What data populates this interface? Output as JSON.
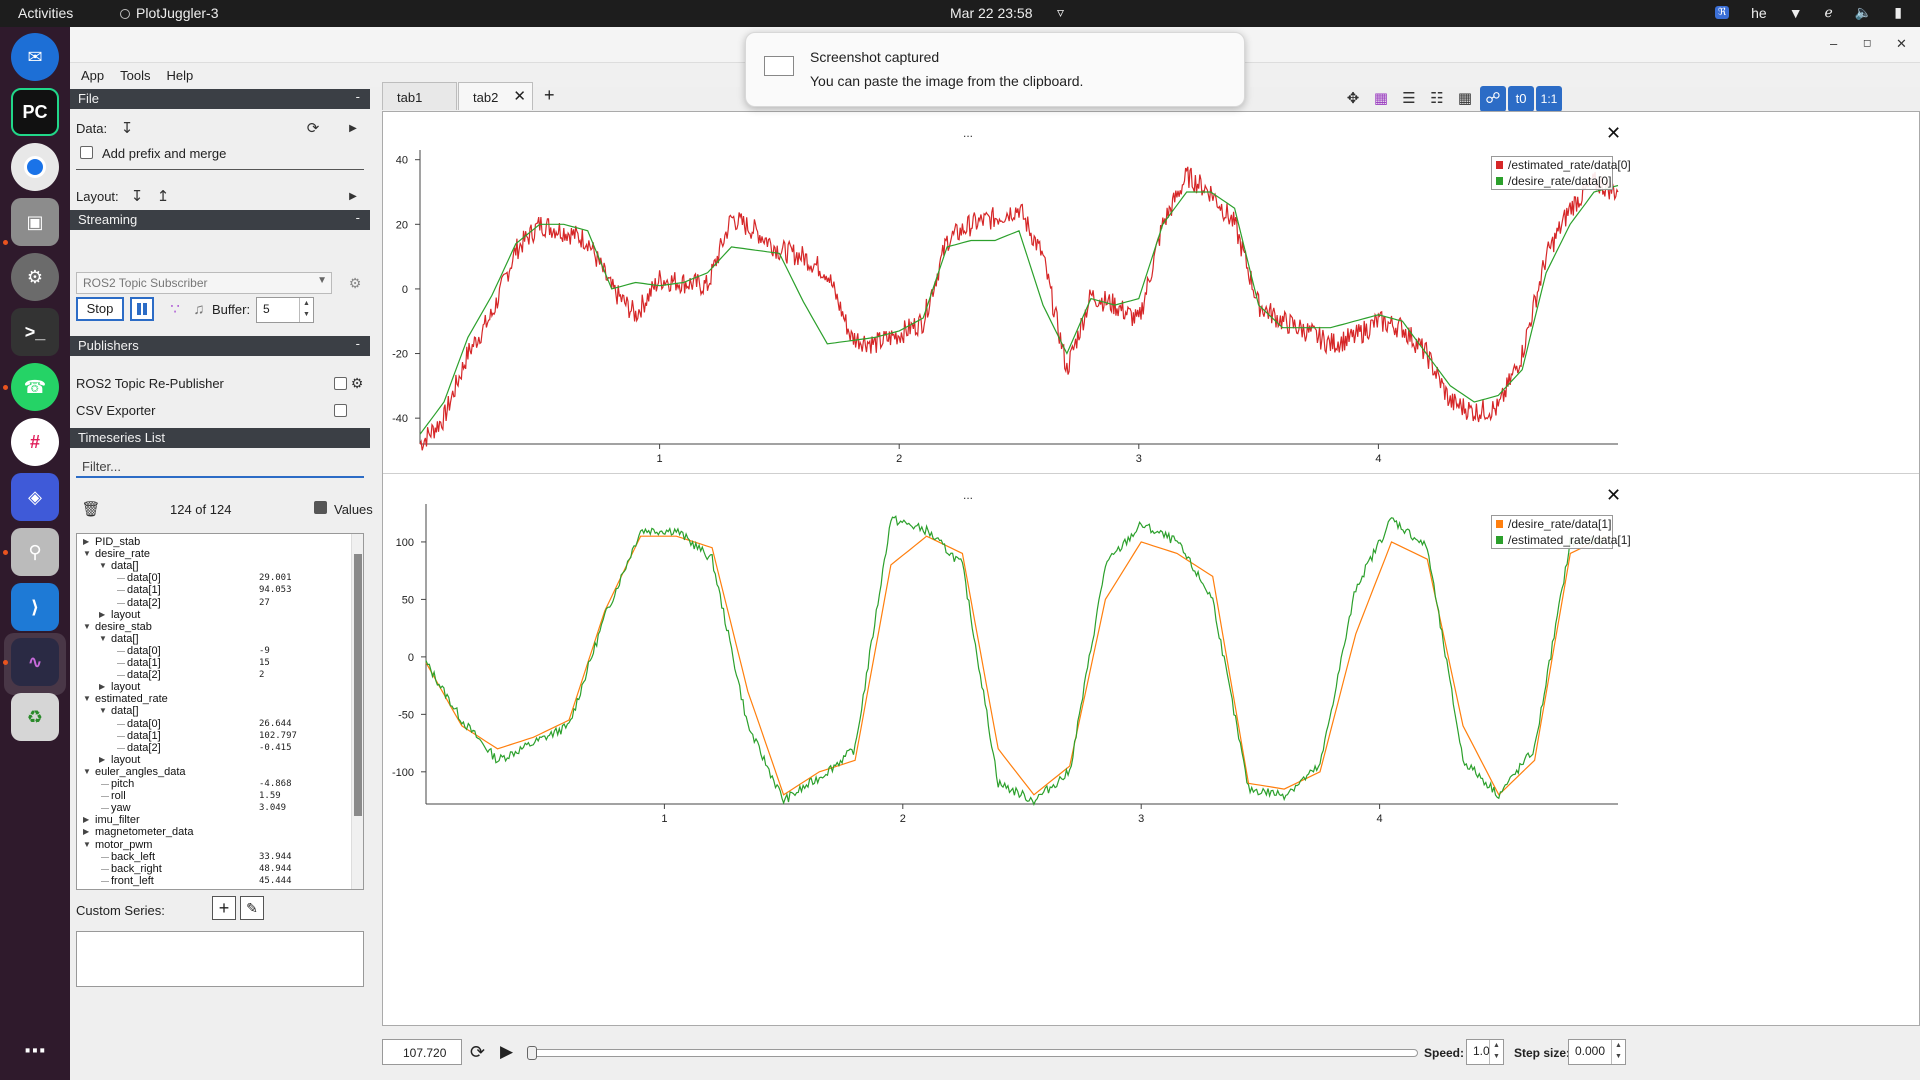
{
  "topbar": {
    "activities": "Activities",
    "app_name": "PlotJuggler-3",
    "clock": "Mar 22  23:58",
    "lang": "he"
  },
  "notification": {
    "title": "Screenshot captured",
    "body": "You can paste the image from the clipboard."
  },
  "menu": [
    "App",
    "Tools",
    "Help"
  ],
  "file": {
    "header": "File",
    "data_label": "Data:",
    "prefix_label": "Add prefix and merge",
    "layout_label": "Layout:"
  },
  "streaming": {
    "header": "Streaming",
    "source": "ROS2 Topic Subscriber",
    "stop_label": "Stop",
    "buffer_label": "Buffer:",
    "buffer_value": "5"
  },
  "publishers": {
    "header": "Publishers",
    "items": [
      "ROS2 Topic Re-Publisher",
      "CSV Exporter"
    ]
  },
  "timeseries": {
    "header": "Timeseries List",
    "filter_placeholder": "Filter...",
    "count": "124 of 124",
    "values_label": "Values",
    "tree": [
      {
        "label": "PID_stab",
        "level": 0,
        "expanded": false
      },
      {
        "label": "desire_rate",
        "level": 0,
        "expanded": true
      },
      {
        "label": "data[]",
        "level": 1,
        "expanded": true
      },
      {
        "label": "data[0]",
        "level": 2,
        "value": "29.001"
      },
      {
        "label": "data[1]",
        "level": 2,
        "value": "94.053"
      },
      {
        "label": "data[2]",
        "level": 2,
        "value": "27"
      },
      {
        "label": "layout",
        "level": 1,
        "expanded": false
      },
      {
        "label": "desire_stab",
        "level": 0,
        "expanded": true
      },
      {
        "label": "data[]",
        "level": 1,
        "expanded": true
      },
      {
        "label": "data[0]",
        "level": 2,
        "value": "-9"
      },
      {
        "label": "data[1]",
        "level": 2,
        "value": "15"
      },
      {
        "label": "data[2]",
        "level": 2,
        "value": "2"
      },
      {
        "label": "layout",
        "level": 1,
        "expanded": false
      },
      {
        "label": "estimated_rate",
        "level": 0,
        "expanded": true
      },
      {
        "label": "data[]",
        "level": 1,
        "expanded": true
      },
      {
        "label": "data[0]",
        "level": 2,
        "value": "26.644"
      },
      {
        "label": "data[1]",
        "level": 2,
        "value": "102.797"
      },
      {
        "label": "data[2]",
        "level": 2,
        "value": "-0.415"
      },
      {
        "label": "layout",
        "level": 1,
        "expanded": false
      },
      {
        "label": "euler_angles_data",
        "level": 0,
        "expanded": true
      },
      {
        "label": "pitch",
        "level": 1,
        "value": "-4.868"
      },
      {
        "label": "roll",
        "level": 1,
        "value": "1.59"
      },
      {
        "label": "yaw",
        "level": 1,
        "value": "3.049"
      },
      {
        "label": "imu_filter",
        "level": 0,
        "expanded": false
      },
      {
        "label": "magnetometer_data",
        "level": 0,
        "expanded": false
      },
      {
        "label": "motor_pwm",
        "level": 0,
        "expanded": true
      },
      {
        "label": "back_left",
        "level": 1,
        "value": "33.944"
      },
      {
        "label": "back_right",
        "level": 1,
        "value": "48.944"
      },
      {
        "label": "front_left",
        "level": 1,
        "value": "45.444"
      }
    ],
    "custom_series_label": "Custom Series:"
  },
  "tabs": [
    {
      "label": "tab1",
      "active": false
    },
    {
      "label": "tab2",
      "active": true
    }
  ],
  "add_tab": "+",
  "toolbar_icons": [
    "move-icon",
    "grid-lines-icon",
    "legend-icon",
    "settings-icon",
    "grid-icon",
    "link-icon",
    "t0-icon",
    "ratio-icon"
  ],
  "toolbar_text": {
    "t0": "t0",
    "ratio": "1:1"
  },
  "plots": {
    "top": {
      "title": "...",
      "legend": [
        "/estimated_rate/data[0]",
        "/desire_rate/data[0]"
      ]
    },
    "bottom": {
      "title": "...",
      "legend": [
        "/desire_rate/data[1]",
        "/estimated_rate/data[1]"
      ]
    }
  },
  "chart_data": [
    {
      "type": "line",
      "xlim": [
        0,
        5
      ],
      "ylim": [
        -48,
        43
      ],
      "xticks": [
        "1",
        "2",
        "3",
        "4"
      ],
      "yticks": [
        "40",
        "20",
        "0",
        "-20",
        "-40"
      ],
      "series": [
        {
          "name": "/estimated_rate/data[0]",
          "color": "#d62728",
          "x": [
            0,
            0.1,
            0.2,
            0.3,
            0.4,
            0.5,
            0.6,
            0.7,
            0.8,
            0.9,
            1.0,
            1.1,
            1.2,
            1.3,
            1.4,
            1.5,
            1.6,
            1.7,
            1.8,
            1.9,
            2.0,
            2.1,
            2.2,
            2.3,
            2.4,
            2.5,
            2.6,
            2.7,
            2.8,
            2.9,
            3.0,
            3.1,
            3.2,
            3.3,
            3.4,
            3.5,
            3.6,
            3.7,
            3.8,
            3.9,
            4.0,
            4.1,
            4.2,
            4.3,
            4.4,
            4.5,
            4.6,
            4.7,
            4.8,
            4.9,
            5.0
          ],
          "y": [
            -48,
            -40,
            -20,
            -8,
            12,
            20,
            18,
            15,
            0,
            -8,
            3,
            2,
            1,
            22,
            18,
            12,
            10,
            5,
            -15,
            -17,
            -14,
            -10,
            15,
            20,
            22,
            25,
            10,
            -25,
            -2,
            -5,
            -10,
            20,
            35,
            30,
            20,
            -5,
            -10,
            -13,
            -17,
            -15,
            -10,
            -12,
            -20,
            -35,
            -38,
            -37,
            -20,
            10,
            25,
            33,
            30
          ]
        },
        {
          "name": "/desire_rate/data[0]",
          "color": "#2ca02c",
          "x": [
            0,
            0.1,
            0.2,
            0.3,
            0.4,
            0.5,
            0.6,
            0.7,
            0.8,
            0.9,
            1.0,
            1.1,
            1.2,
            1.3,
            1.4,
            1.5,
            1.6,
            1.7,
            1.8,
            1.9,
            2.0,
            2.1,
            2.2,
            2.3,
            2.4,
            2.5,
            2.6,
            2.7,
            2.8,
            2.9,
            3.0,
            3.1,
            3.2,
            3.3,
            3.4,
            3.5,
            3.6,
            3.7,
            3.8,
            3.9,
            4.0,
            4.1,
            4.2,
            4.3,
            4.4,
            4.5,
            4.6,
            4.7,
            4.8,
            4.9,
            5.0
          ],
          "y": [
            -45,
            -35,
            -15,
            -2,
            14,
            20,
            20,
            18,
            0,
            2,
            1,
            2,
            5,
            13,
            12,
            11,
            -4,
            -17,
            -16,
            -15,
            -13,
            -9,
            13,
            15,
            15,
            18,
            -5,
            -20,
            -3,
            -5,
            -3,
            20,
            30,
            30,
            25,
            -5,
            -12,
            -12,
            -12,
            -10,
            -8,
            -10,
            -20,
            -30,
            -35,
            -33,
            -25,
            5,
            20,
            30,
            32
          ]
        }
      ]
    },
    {
      "type": "line",
      "xlim": [
        0,
        5
      ],
      "ylim": [
        -128,
        133
      ],
      "xticks": [
        "1",
        "2",
        "3",
        "4"
      ],
      "yticks": [
        "100",
        "50",
        "0",
        "-50",
        "-100"
      ],
      "series": [
        {
          "name": "/desire_rate/data[1]",
          "color": "#ff7f0e",
          "x": [
            0,
            0.15,
            0.3,
            0.45,
            0.6,
            0.75,
            0.9,
            1.05,
            1.2,
            1.35,
            1.5,
            1.65,
            1.8,
            1.95,
            2.1,
            2.25,
            2.4,
            2.55,
            2.7,
            2.85,
            3.0,
            3.15,
            3.3,
            3.45,
            3.6,
            3.75,
            3.9,
            4.05,
            4.2,
            4.35,
            4.5,
            4.65,
            4.8,
            4.95
          ],
          "y": [
            -5,
            -60,
            -80,
            -70,
            -55,
            40,
            105,
            105,
            95,
            -30,
            -120,
            -100,
            -90,
            80,
            105,
            90,
            -80,
            -120,
            -95,
            50,
            100,
            90,
            70,
            -110,
            -115,
            -100,
            20,
            100,
            85,
            -60,
            -120,
            -90,
            90,
            105
          ]
        },
        {
          "name": "/estimated_rate/data[1]",
          "color": "#2ca02c",
          "x": [
            0,
            0.15,
            0.3,
            0.45,
            0.6,
            0.75,
            0.9,
            1.05,
            1.2,
            1.35,
            1.5,
            1.65,
            1.8,
            1.95,
            2.1,
            2.25,
            2.4,
            2.55,
            2.7,
            2.85,
            3.0,
            3.15,
            3.3,
            3.45,
            3.6,
            3.75,
            3.9,
            4.05,
            4.2,
            4.35,
            4.5,
            4.65,
            4.8,
            4.95
          ],
          "y": [
            -5,
            -55,
            -90,
            -75,
            -60,
            35,
            110,
            110,
            85,
            -60,
            -125,
            -105,
            -80,
            120,
            110,
            80,
            -110,
            -125,
            -100,
            80,
            115,
            100,
            50,
            -115,
            -120,
            -95,
            60,
            120,
            95,
            -90,
            -120,
            -80,
            100,
            100
          ]
        }
      ]
    }
  ],
  "bottom": {
    "time": "107.720",
    "speed_label": "Speed:",
    "speed_value": "1.0",
    "step_label": "Step size:",
    "step_value": "0.000"
  },
  "colors": {
    "accent": "#2c6cc6",
    "header_bg": "#3b3f45",
    "dock_bg": "#2f1a2c"
  }
}
